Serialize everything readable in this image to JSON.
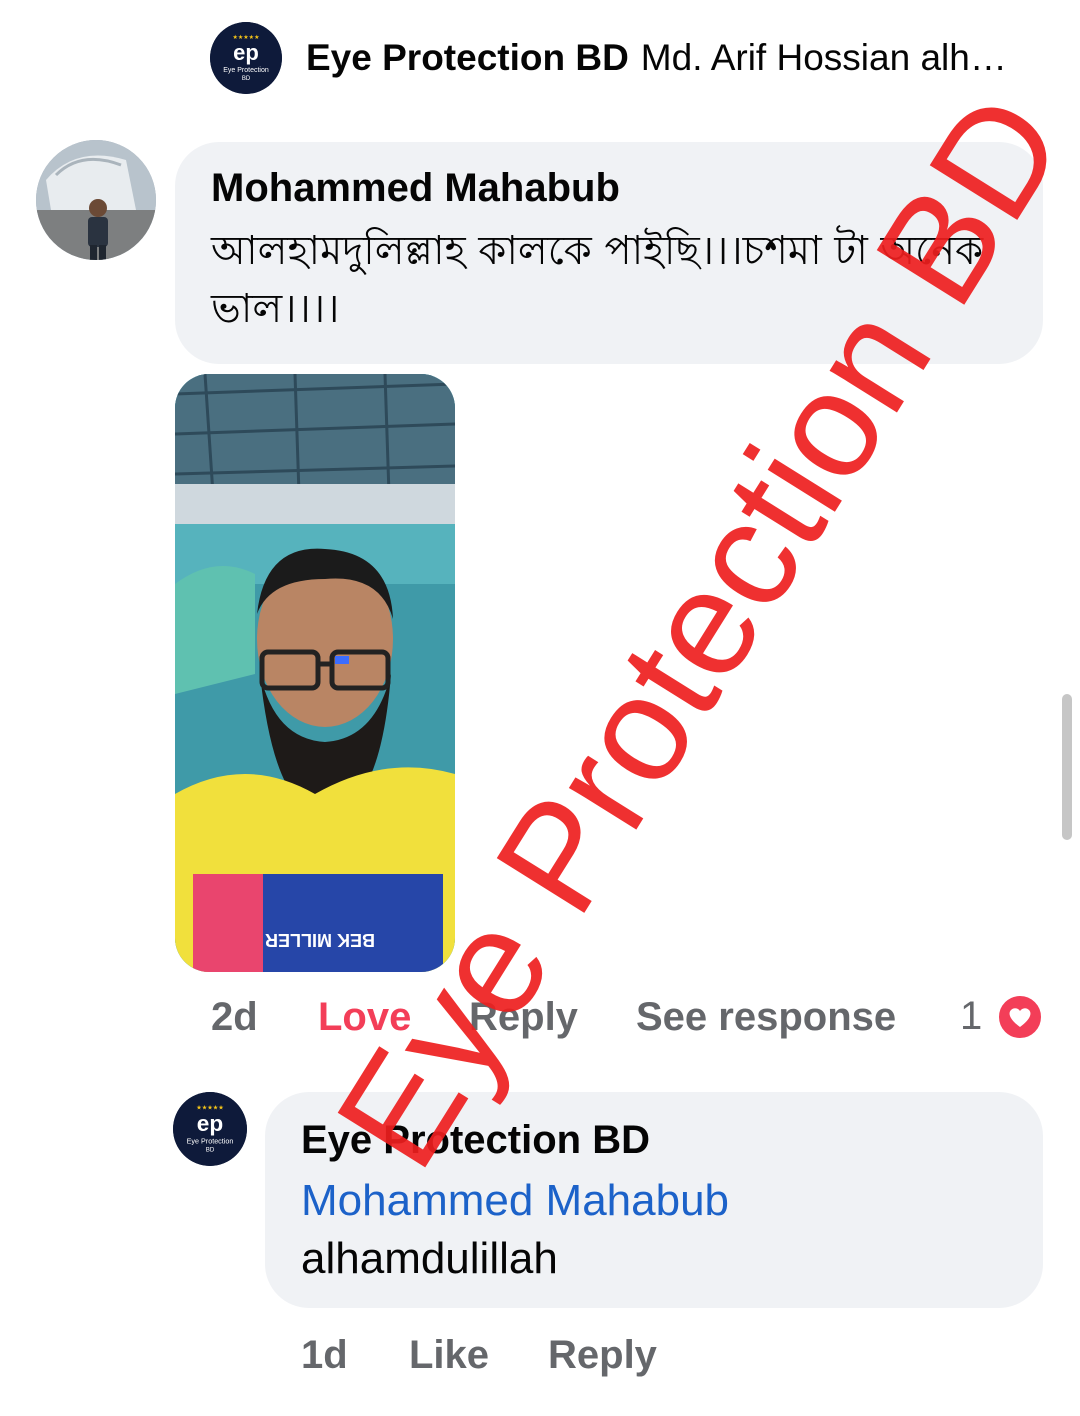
{
  "top_reply": {
    "author": "Eye Protection BD",
    "preview": "Md. Arif Hossian alh…",
    "avatar_text": "Eye Protection BD"
  },
  "comment": {
    "author": "Mohammed Mahabub",
    "text": "আলহামদুলিল্লাহ  কালকে পাইছি।।।চশমা টা অনেক ভাল।।।।",
    "photo_shirt_text": "BEK MILLER",
    "time": "2d",
    "love_label": "Love",
    "reply_label": "Reply",
    "see_response_label": "See response",
    "reaction_count": "1"
  },
  "reply": {
    "author": "Eye Protection BD",
    "avatar_text": "Eye Protection BD",
    "mention": "Mohammed Mahabub",
    "text": "alhamdulillah",
    "time": "1d",
    "like_label": "Like",
    "reply_label": "Reply"
  },
  "watermark": "Eye Protection BD",
  "colors": {
    "bubble": "#f0f2f5",
    "love": "#f33e58",
    "mention": "#1c62c9",
    "muted": "#65676b",
    "watermark": "#ee1e1e",
    "brand_dark": "#0e1a3a"
  }
}
